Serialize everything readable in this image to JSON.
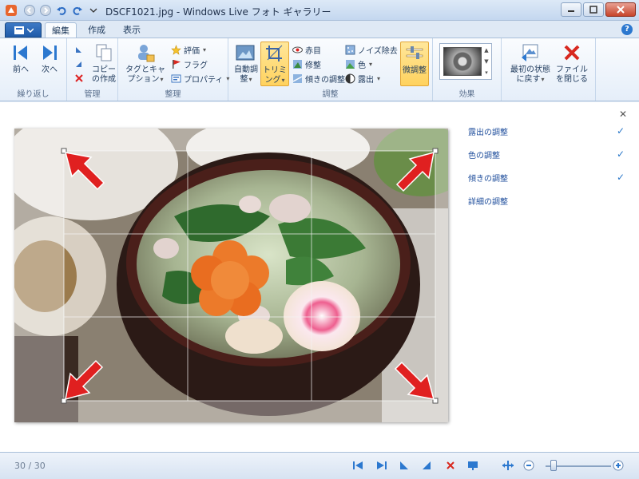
{
  "window": {
    "title": "DSCF1021.jpg - Windows Live フォト ギャラリー"
  },
  "tabs": [
    {
      "label": "編集",
      "active": true
    },
    {
      "label": "作成",
      "active": false
    },
    {
      "label": "表示",
      "active": false
    }
  ],
  "ribbon": {
    "groups": {
      "browse": "繰り返し",
      "manage": "管理",
      "organize": "整理",
      "adjust": "調整",
      "effects": "効果"
    },
    "prev_label": "前へ",
    "next_label": "次へ",
    "copy_label": "コピーの作成",
    "tag_caption_label": "タグとキャプション",
    "rating_label": "評価",
    "flag_label": "フラグ",
    "properties_label": "プロパティ",
    "auto_adjust_label": "自動調整",
    "crop_label": "トリミング",
    "redeye_label": "赤目",
    "retouch_label": "修整",
    "straighten_label": "傾きの調整",
    "noise_label": "ノイズ除去",
    "color_label": "色",
    "exposure_label": "露出",
    "fine_tune_label": "微調整",
    "revert_label": "最初の状態に戻す",
    "close_file_label": "ファイルを閉じる"
  },
  "side_panel": {
    "items": [
      {
        "label": "露出の調整",
        "checked": true
      },
      {
        "label": "色の調整",
        "checked": true
      },
      {
        "label": "傾きの調整",
        "checked": true
      },
      {
        "label": "詳細の調整",
        "checked": false
      }
    ]
  },
  "status": {
    "photo_count": "30 / 30",
    "zoom_level": 0.12
  },
  "colors": {
    "accent": "#2c78cf",
    "highlight": "#ffd25e",
    "arrow": "#e02020"
  }
}
